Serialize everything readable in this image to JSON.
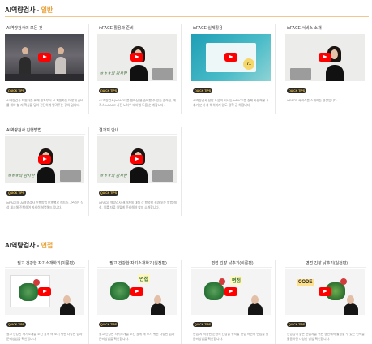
{
  "section1": {
    "title_prefix": "AI역량검사 - ",
    "title_accent": "일반",
    "cards": [
      {
        "title": "AI역량검사의 모든 것",
        "badge": "QUICK TIPS",
        "desc": "AI역량검사 지원자를 위해 원자부터 모 지원자는 어떻게 준비를 해야 할 지 핵심을 담아 간단하게 알려주는 강의 입니다."
      },
      {
        "title": "inFACE 활용과 준비",
        "badge": "QUICK TIPS",
        "desc": "AI 역량검사(inFACE)를 원하신 분 준비할 수 있는 순하신, 예로스 inFACE 사전 노하우 대비법 도움 순 개합니다."
      },
      {
        "title": "inFACE 실제활용",
        "badge": "QUICK TIPS",
        "desc": "AI역량검사 전반 도움이 되시는 inFACE를 실제 사용해본 후 추가 분석 과 해석까지 입도 정확 공 해합니다."
      },
      {
        "title": "inFACE 서비스 소개",
        "badge": "QUICK TIPS",
        "desc": "inFACE 서비스를 소개하는 영상입니다."
      },
      {
        "title": "AI역량검사 진행방법",
        "badge": "QUICK TIPS",
        "desc": "inFACE와 AI역량검사 진행방법 단계별로 해드스 - 온라인 작성 체크해 진행하여 자세히 설명해드립니다."
      },
      {
        "title": "결과지 안내",
        "badge": "QUICK TIPS",
        "desc": "inFACE 역량검사 결과지에 대해 각 항목별 결과 읽는 방법 해석, 이를 자료 어떻게 준비해야 할지 소개합니다."
      }
    ]
  },
  "section2": {
    "title_prefix": "AI역량검사 - ",
    "title_accent": "면접",
    "cards": [
      {
        "title": "필고 건강한 자기소개하기(이론편)",
        "badge": "QUICK TIPS",
        "desc": "필고 건강한 자기소개를 조건 알게 해 보기 위한 다양한 팁과 준비방법을 확인합니다."
      },
      {
        "title": "필고 건강한 자기소개하기(실전편)",
        "badge": "QUICK TIPS",
        "desc": "필고 건강한 자기소개를 조건 알게 해 보기 위한 다양한 팁과 준비방법을 확인합니다."
      },
      {
        "title": "면접 긴장 낮추기(이론편)",
        "badge": "QUICK TIPS",
        "desc": "면접 시 적용한 순환의 긴장을 유지할 면접 하면서 면접을 잘 준비방법을 확인합니다."
      },
      {
        "title": "면접 긴장 낮추기(실전편)",
        "badge": "QUICK TIPS",
        "desc": "긴장감이 높은 면접자를 위한 실전에서 활용할 수 있는 선택을 활용하면 다양한 방법 확인합니다."
      }
    ],
    "thumb_labels": [
      "면접",
      "면접",
      "CODE"
    ]
  },
  "thumb_text": {
    "teal_number": "71",
    "sign_text": "ㅎㅎㅎ의 감사한"
  },
  "colors": {
    "accent": "#e9a23b",
    "play": "#ff0000",
    "badge_bg": "#2a2a2a",
    "badge_fg": "#f5c542"
  }
}
